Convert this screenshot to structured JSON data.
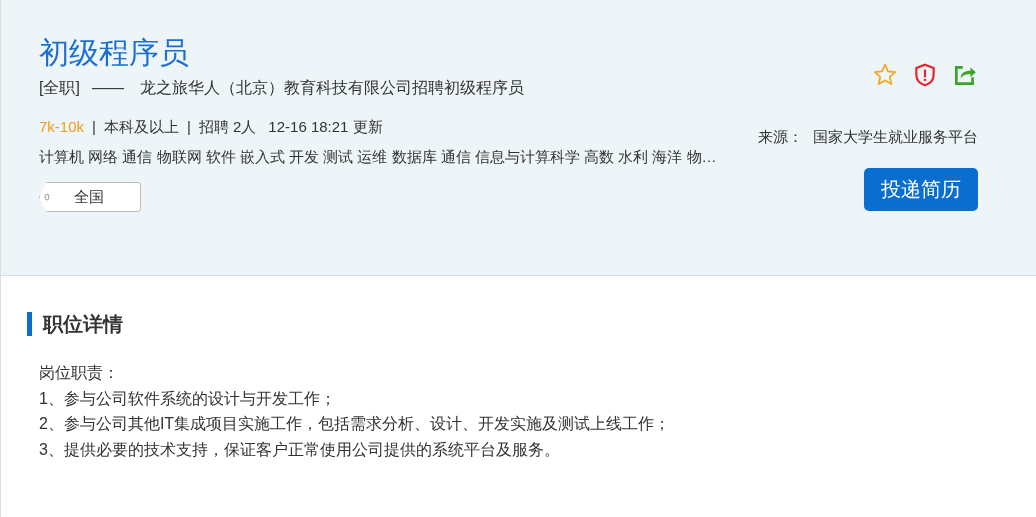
{
  "job": {
    "title": "初级程序员",
    "employment_type": "[全职]",
    "dash": "——",
    "company_line": "龙之旅华人（北京）教育科技有限公司招聘初级程序员",
    "salary": "7k-10k",
    "education": "本科及以上",
    "headcount": "招聘 2人",
    "updated": "12-16 18:21 更新",
    "separator": "|",
    "tags": "计算机 网络 通信 物联网 软件 嵌入式 开发 测试 运维 数据库 通信 信息与计算科学 高数 水利 海洋 物…",
    "location": "全国",
    "source_label": "来源：",
    "source": "国家大学生就业服务平台",
    "apply_button": "投递简历"
  },
  "details": {
    "heading": "职位详情",
    "lines": [
      "岗位职责：",
      "1、参与公司软件系统的设计与开发工作；",
      "2、参与公司其他IT集成项目实施工作，包括需求分析、设计、开发实施及测试上线工作；",
      "3、提供必要的技术支持，保证客户正常使用公司提供的系统平台及服务。"
    ]
  }
}
